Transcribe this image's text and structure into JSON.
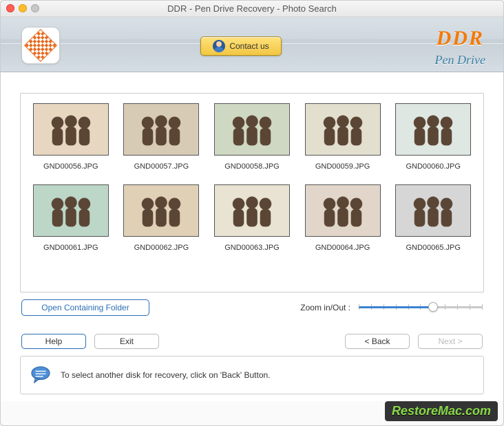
{
  "window": {
    "title": "DDR - Pen Drive Recovery - Photo Search"
  },
  "header": {
    "contact_label": "Contact us",
    "brand_title": "DDR",
    "brand_sub": "Pen Drive"
  },
  "thumbnails": [
    {
      "filename": "GND00056.JPG"
    },
    {
      "filename": "GND00057.JPG"
    },
    {
      "filename": "GND00058.JPG"
    },
    {
      "filename": "GND00059.JPG"
    },
    {
      "filename": "GND00060.JPG"
    },
    {
      "filename": "GND00061.JPG"
    },
    {
      "filename": "GND00062.JPG"
    },
    {
      "filename": "GND00063.JPG"
    },
    {
      "filename": "GND00064.JPG"
    },
    {
      "filename": "GND00065.JPG"
    }
  ],
  "controls": {
    "open_folder": "Open Containing Folder",
    "zoom_label": "Zoom in/Out :"
  },
  "buttons": {
    "help": "Help",
    "exit": "Exit",
    "back": "< Back",
    "next": "Next >"
  },
  "hint": {
    "text": "To select another disk for recovery, click on 'Back' Button."
  },
  "watermark": "RestoreMac.com"
}
